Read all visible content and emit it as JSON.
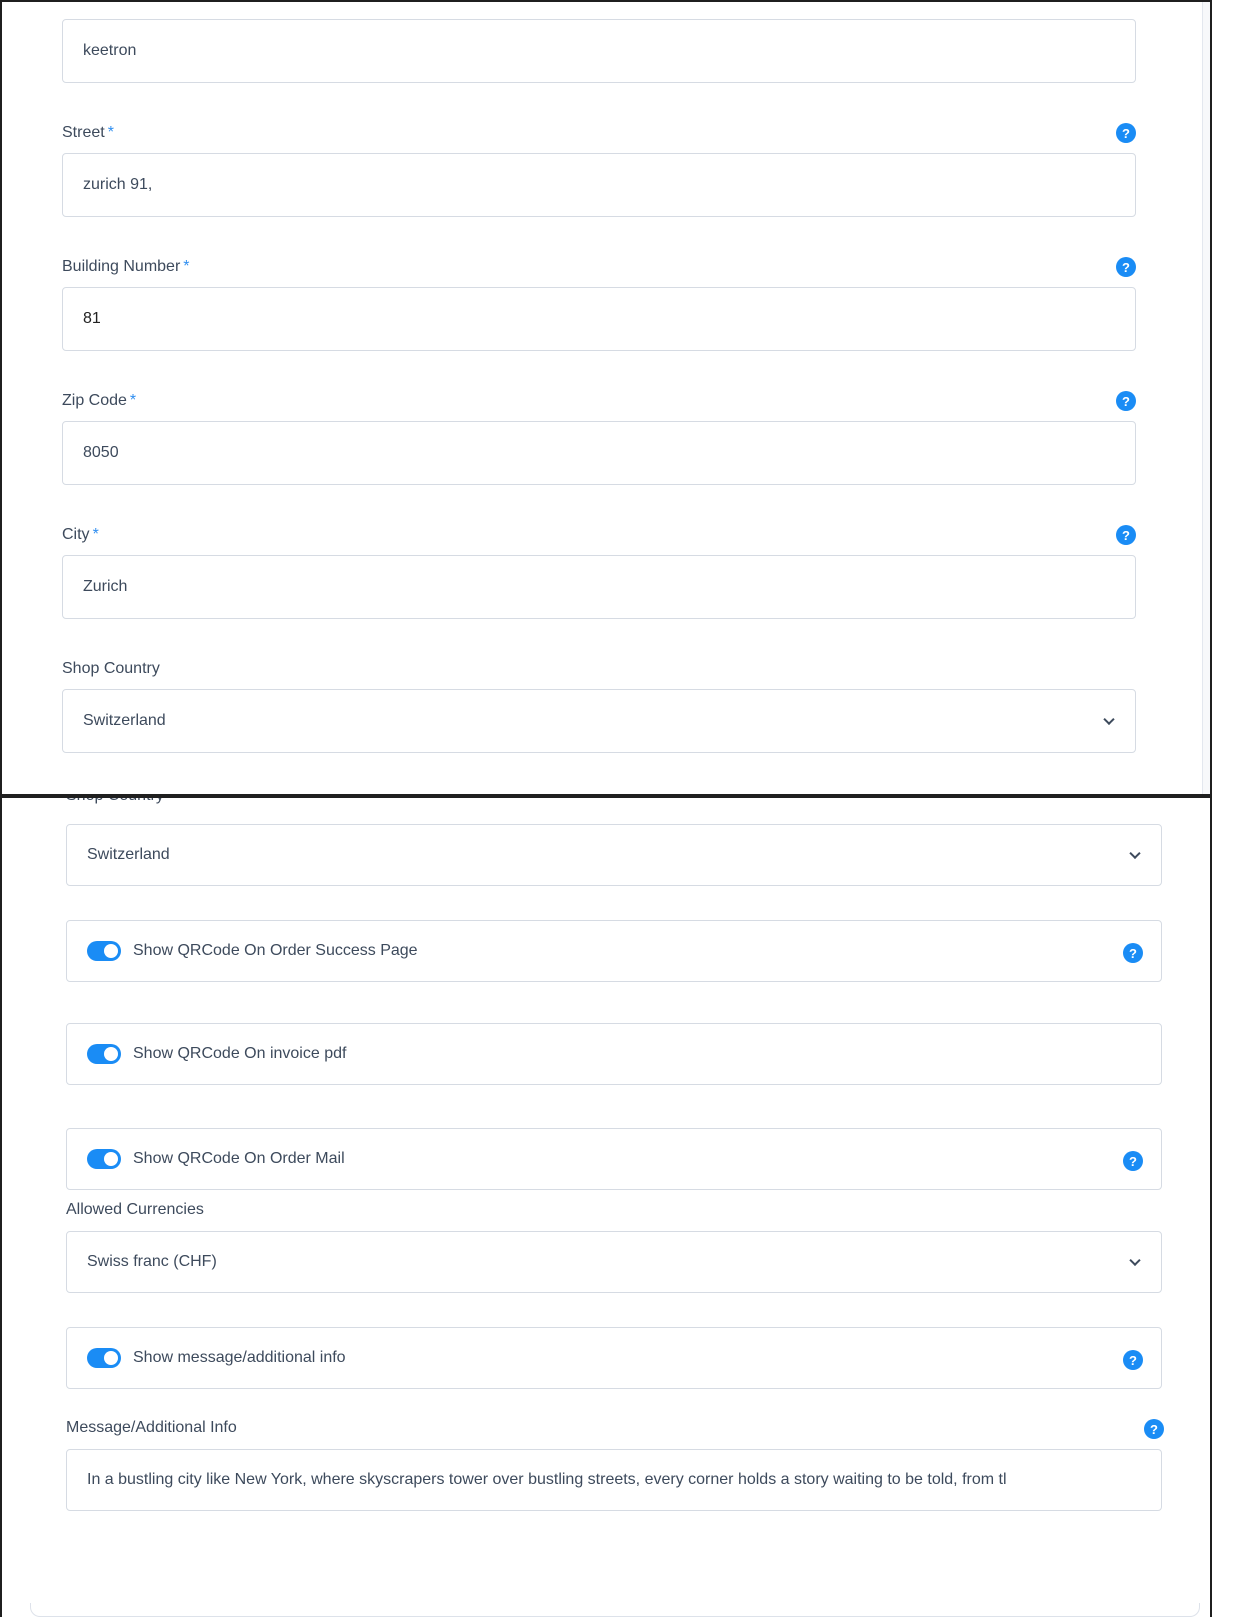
{
  "top": {
    "shop_name_value": "keetron",
    "street": {
      "label": "Street",
      "required": "*",
      "value": "zurich 91,"
    },
    "building": {
      "label": "Building Number",
      "required": "*",
      "value": "81"
    },
    "zip": {
      "label": "Zip Code",
      "required": "*",
      "value": "8050"
    },
    "city": {
      "label": "City",
      "required": "*",
      "value": "Zurich"
    },
    "country": {
      "label": "Shop Country",
      "value": "Switzerland"
    }
  },
  "bottom": {
    "country_label_partial": "Shop Country",
    "country_value": "Switzerland",
    "toggles": [
      {
        "label": "Show QRCode On Order Success Page",
        "checked": true,
        "help": true
      },
      {
        "label": "Show QRCode On invoice pdf",
        "checked": true,
        "help": false
      },
      {
        "label": "Show QRCode On Order Mail",
        "checked": true,
        "help": true
      }
    ],
    "currencies": {
      "label": "Allowed Currencies",
      "value": "Swiss franc (CHF)"
    },
    "message_toggle": {
      "label": "Show message/additional info",
      "checked": true
    },
    "message": {
      "label": "Message/Additional Info",
      "value": "In a bustling city like New York, where skyscrapers tower over bustling streets, every corner holds a story waiting to be told, from tl"
    }
  },
  "help_glyph": "?",
  "colors": {
    "accent": "#1a8cf5",
    "border": "#d6dbe3",
    "text": "#3d4a5c"
  }
}
